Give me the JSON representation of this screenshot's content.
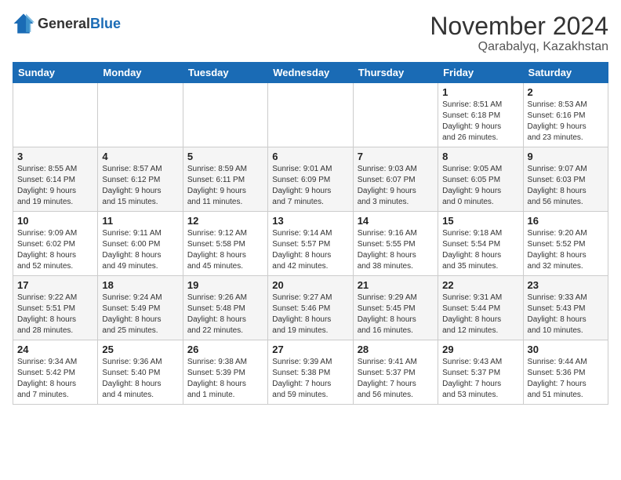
{
  "header": {
    "logo_general": "General",
    "logo_blue": "Blue",
    "month_title": "November 2024",
    "location": "Qarabalyq, Kazakhstan"
  },
  "weekdays": [
    "Sunday",
    "Monday",
    "Tuesday",
    "Wednesday",
    "Thursday",
    "Friday",
    "Saturday"
  ],
  "weeks": [
    [
      {
        "day": "",
        "info": ""
      },
      {
        "day": "",
        "info": ""
      },
      {
        "day": "",
        "info": ""
      },
      {
        "day": "",
        "info": ""
      },
      {
        "day": "",
        "info": ""
      },
      {
        "day": "1",
        "info": "Sunrise: 8:51 AM\nSunset: 6:18 PM\nDaylight: 9 hours\nand 26 minutes."
      },
      {
        "day": "2",
        "info": "Sunrise: 8:53 AM\nSunset: 6:16 PM\nDaylight: 9 hours\nand 23 minutes."
      }
    ],
    [
      {
        "day": "3",
        "info": "Sunrise: 8:55 AM\nSunset: 6:14 PM\nDaylight: 9 hours\nand 19 minutes."
      },
      {
        "day": "4",
        "info": "Sunrise: 8:57 AM\nSunset: 6:12 PM\nDaylight: 9 hours\nand 15 minutes."
      },
      {
        "day": "5",
        "info": "Sunrise: 8:59 AM\nSunset: 6:11 PM\nDaylight: 9 hours\nand 11 minutes."
      },
      {
        "day": "6",
        "info": "Sunrise: 9:01 AM\nSunset: 6:09 PM\nDaylight: 9 hours\nand 7 minutes."
      },
      {
        "day": "7",
        "info": "Sunrise: 9:03 AM\nSunset: 6:07 PM\nDaylight: 9 hours\nand 3 minutes."
      },
      {
        "day": "8",
        "info": "Sunrise: 9:05 AM\nSunset: 6:05 PM\nDaylight: 9 hours\nand 0 minutes."
      },
      {
        "day": "9",
        "info": "Sunrise: 9:07 AM\nSunset: 6:03 PM\nDaylight: 8 hours\nand 56 minutes."
      }
    ],
    [
      {
        "day": "10",
        "info": "Sunrise: 9:09 AM\nSunset: 6:02 PM\nDaylight: 8 hours\nand 52 minutes."
      },
      {
        "day": "11",
        "info": "Sunrise: 9:11 AM\nSunset: 6:00 PM\nDaylight: 8 hours\nand 49 minutes."
      },
      {
        "day": "12",
        "info": "Sunrise: 9:12 AM\nSunset: 5:58 PM\nDaylight: 8 hours\nand 45 minutes."
      },
      {
        "day": "13",
        "info": "Sunrise: 9:14 AM\nSunset: 5:57 PM\nDaylight: 8 hours\nand 42 minutes."
      },
      {
        "day": "14",
        "info": "Sunrise: 9:16 AM\nSunset: 5:55 PM\nDaylight: 8 hours\nand 38 minutes."
      },
      {
        "day": "15",
        "info": "Sunrise: 9:18 AM\nSunset: 5:54 PM\nDaylight: 8 hours\nand 35 minutes."
      },
      {
        "day": "16",
        "info": "Sunrise: 9:20 AM\nSunset: 5:52 PM\nDaylight: 8 hours\nand 32 minutes."
      }
    ],
    [
      {
        "day": "17",
        "info": "Sunrise: 9:22 AM\nSunset: 5:51 PM\nDaylight: 8 hours\nand 28 minutes."
      },
      {
        "day": "18",
        "info": "Sunrise: 9:24 AM\nSunset: 5:49 PM\nDaylight: 8 hours\nand 25 minutes."
      },
      {
        "day": "19",
        "info": "Sunrise: 9:26 AM\nSunset: 5:48 PM\nDaylight: 8 hours\nand 22 minutes."
      },
      {
        "day": "20",
        "info": "Sunrise: 9:27 AM\nSunset: 5:46 PM\nDaylight: 8 hours\nand 19 minutes."
      },
      {
        "day": "21",
        "info": "Sunrise: 9:29 AM\nSunset: 5:45 PM\nDaylight: 8 hours\nand 16 minutes."
      },
      {
        "day": "22",
        "info": "Sunrise: 9:31 AM\nSunset: 5:44 PM\nDaylight: 8 hours\nand 12 minutes."
      },
      {
        "day": "23",
        "info": "Sunrise: 9:33 AM\nSunset: 5:43 PM\nDaylight: 8 hours\nand 10 minutes."
      }
    ],
    [
      {
        "day": "24",
        "info": "Sunrise: 9:34 AM\nSunset: 5:42 PM\nDaylight: 8 hours\nand 7 minutes."
      },
      {
        "day": "25",
        "info": "Sunrise: 9:36 AM\nSunset: 5:40 PM\nDaylight: 8 hours\nand 4 minutes."
      },
      {
        "day": "26",
        "info": "Sunrise: 9:38 AM\nSunset: 5:39 PM\nDaylight: 8 hours\nand 1 minute."
      },
      {
        "day": "27",
        "info": "Sunrise: 9:39 AM\nSunset: 5:38 PM\nDaylight: 7 hours\nand 59 minutes."
      },
      {
        "day": "28",
        "info": "Sunrise: 9:41 AM\nSunset: 5:37 PM\nDaylight: 7 hours\nand 56 minutes."
      },
      {
        "day": "29",
        "info": "Sunrise: 9:43 AM\nSunset: 5:37 PM\nDaylight: 7 hours\nand 53 minutes."
      },
      {
        "day": "30",
        "info": "Sunrise: 9:44 AM\nSunset: 5:36 PM\nDaylight: 7 hours\nand 51 minutes."
      }
    ]
  ]
}
